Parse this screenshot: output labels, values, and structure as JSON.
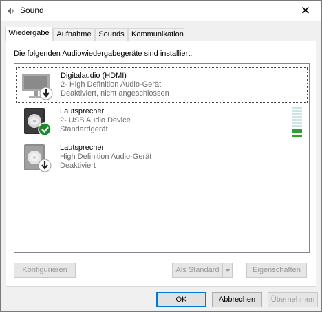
{
  "window": {
    "title": "Sound",
    "title_icon": "speaker-icon",
    "close_glyph": "✕"
  },
  "tabs": [
    {
      "label": "Wiedergabe",
      "active": true
    },
    {
      "label": "Aufnahme",
      "active": false
    },
    {
      "label": "Sounds",
      "active": false
    },
    {
      "label": "Kommunikation",
      "active": false
    }
  ],
  "playback": {
    "intro": "Die folgenden Audiowiedergabegeräte sind installiert:",
    "devices": [
      {
        "name": "Digitalaudio (HDMI)",
        "driver": "2- High Definition Audio-Gerät",
        "status": "Deaktiviert, nicht angeschlossen",
        "icon": "monitor-icon",
        "badge": "down-arrow-badge-icon",
        "selected": true
      },
      {
        "name": "Lautsprecher",
        "driver": "2- USB Audio Device",
        "status": "Standardgerät",
        "icon": "speaker-box-icon",
        "badge": "green-check-badge-icon",
        "selected": false,
        "level_segments_lit": 3,
        "level_segments_total": 10
      },
      {
        "name": "Lautsprecher",
        "driver": "High Definition Audio-Gerät",
        "status": "Deaktiviert",
        "icon": "speaker-box-icon",
        "badge": "down-arrow-badge-icon",
        "selected": false
      }
    ],
    "buttons": {
      "configure": "Konfigurieren",
      "set_default": "Als Standard",
      "properties": "Eigenschaften"
    }
  },
  "footer": {
    "ok": "OK",
    "cancel": "Abbrechen",
    "apply": "Übernehmen"
  },
  "colors": {
    "accent": "#0078d7",
    "level_on": "#30a030",
    "level_off": "#cfe3e6",
    "check_badge": "#1a8a2a"
  }
}
